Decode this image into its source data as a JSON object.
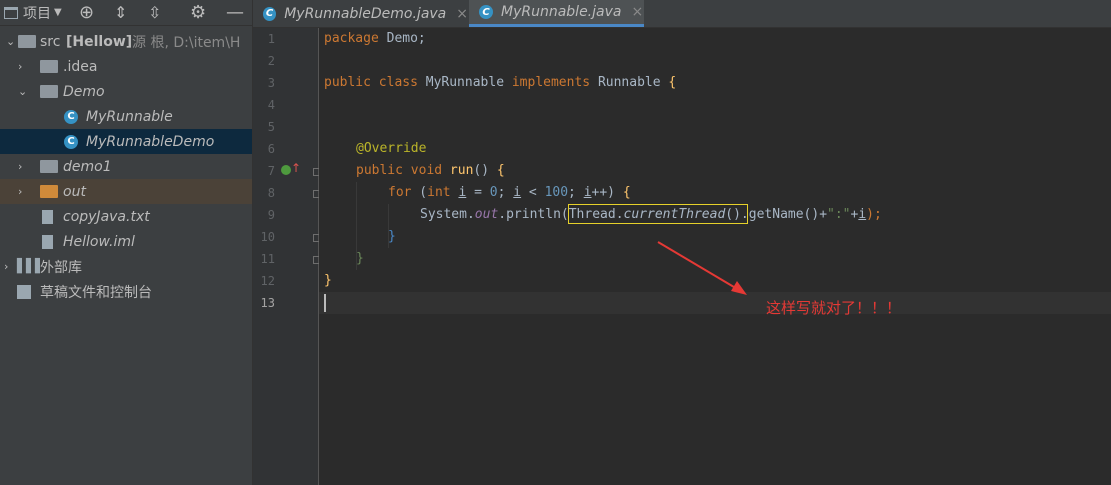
{
  "left_panel": {
    "toolbar": {
      "title": "项目"
    },
    "tree": [
      {
        "name": "tree-item-src",
        "label": "src",
        "bold": "[Hellow]",
        "extra": "源 根, D:\\item\\H"
      },
      {
        "name": "tree-item-idea",
        "label": ".idea"
      },
      {
        "name": "tree-item-demo",
        "label": "Demo"
      },
      {
        "name": "tree-item-myrunnable",
        "label": "MyRunnable"
      },
      {
        "name": "tree-item-myrunnabledemo",
        "label": "MyRunnableDemo"
      },
      {
        "name": "tree-item-demo1",
        "label": "demo1"
      },
      {
        "name": "tree-item-out",
        "label": "out"
      },
      {
        "name": "tree-item-copyjava",
        "label": "copyJava.txt"
      },
      {
        "name": "tree-item-hellow-iml",
        "label": "Hellow.iml"
      },
      {
        "name": "tree-item-external-libs",
        "label": "外部库"
      },
      {
        "name": "tree-item-scratches",
        "label": "草稿文件和控制台"
      }
    ]
  },
  "tabs": [
    {
      "label": "MyRunnableDemo.java",
      "close": "×"
    },
    {
      "label": "MyRunnable.java",
      "close": "×"
    }
  ],
  "editor": {
    "line_numbers": [
      "1",
      "2",
      "3",
      "4",
      "5",
      "6",
      "7",
      "8",
      "9",
      "10",
      "11",
      "12",
      "13"
    ],
    "lines": {
      "l1_kw": "package",
      "l1_rest": " Demo;",
      "l3_kw1": "public class",
      "l3_name": " MyRunnable ",
      "l3_kw2": "implements",
      "l3_rest": " Runnable ",
      "l3_brace": "{",
      "l6_ann": "@Override",
      "l7_kw": "public void",
      "l7_fn": " run",
      "l7_rest": "() ",
      "l7_brace": "{",
      "l8_kw": "for",
      "l8_a": " (",
      "l8_kw2": "int",
      "l8_i1": "i",
      "l8_b": " = ",
      "l8_n0": "0",
      "l8_c": "; ",
      "l8_i2": "i",
      "l8_d": " < ",
      "l8_n100": "100",
      "l8_e": "; ",
      "l8_i3": "i",
      "l8_f": "++) ",
      "l8_brace": "{",
      "l9_a": "System.",
      "l9_out": "out",
      "l9_b": ".println(",
      "l9_thread": "Thread.",
      "l9_ct": "currentThread",
      "l9_c": "().getName()+",
      "l9_str": "\":\"",
      "l9_plus": "+",
      "l9_i": "i",
      "l9_d": ");",
      "l10": "}",
      "l11": "}",
      "l12": "}"
    }
  },
  "annotation": {
    "text": "这样写就对了！！！",
    "color": "#e53935"
  }
}
